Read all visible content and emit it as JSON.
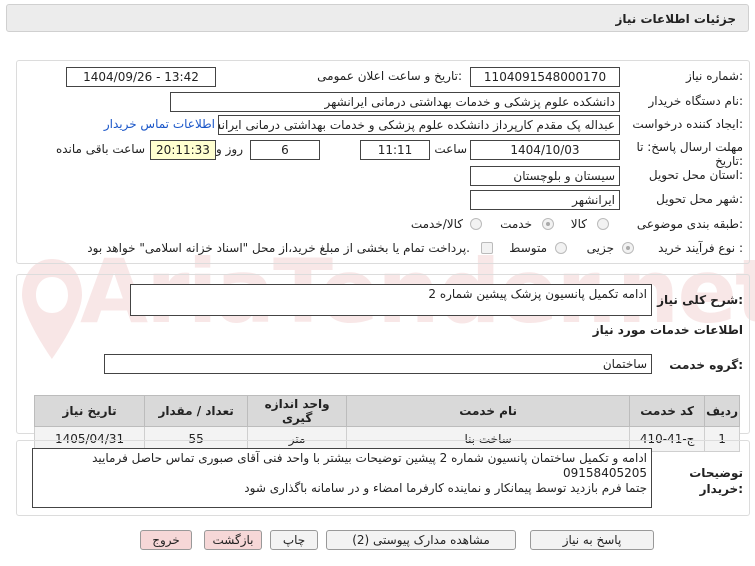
{
  "header": {
    "title": "جزئیات اطلاعات نیاز"
  },
  "watermark": "AriaTender.net",
  "form": {
    "need_number_label": "شماره نیاز:",
    "need_number": "1104091548000170",
    "announce_label": "تاریخ و ساعت اعلان عمومی:",
    "announce_value": "1404/09/26 - 13:42",
    "buyer_label": "نام دستگاه خریدار:",
    "buyer_value": "دانشکده علوم پزشکی و خدمات بهداشتی درمانی ایرانشهر",
    "creator_label": "ایجاد کننده درخواست:",
    "creator_value": "عبداله پک مقدم کارپرداز دانشکده علوم پزشکی و خدمات بهداشتی درمانی ایرانشهر",
    "contact_link": "اطلاعات تماس خریدار",
    "deadline_label": "مهلت ارسال پاسخ: تا تاریخ:",
    "deadline_date": "1404/10/03",
    "time_label": "ساعت",
    "deadline_time": "11:11",
    "days_value": "6",
    "days_label": "روز و",
    "remaining_time": "20:11:33",
    "remaining_label": "ساعت باقی مانده",
    "province_label": "استان محل تحویل:",
    "province_value": "سیستان و بلوچستان",
    "city_label": "شهر محل تحویل:",
    "city_value": "ایرانشهر",
    "category_label": "طبقه بندی موضوعی:",
    "category_options": [
      "کالا",
      "خدمت",
      "کالا/خدمت"
    ],
    "process_label": "نوع فرآیند خرید :",
    "process_options": [
      "جزیی",
      "متوسط"
    ],
    "payment_note": "پرداخت تمام یا بخشی از مبلغ خرید،از محل \"اسناد خزانه اسلامی\" خواهد بود."
  },
  "summary": {
    "label": "شرح کلی نیاز:",
    "value": "ادامه تکمیل پانسیون پزشک پیشین شماره 2"
  },
  "services": {
    "section_title": "اطلاعات خدمات مورد نیاز",
    "group_label": "گروه خدمت:",
    "group_value": "ساختمان",
    "columns": [
      "ردیف",
      "کد خدمت",
      "نام خدمت",
      "واحد اندازه گیری",
      "تعداد / مقدار",
      "تاریخ نیاز"
    ],
    "rows": [
      [
        "1",
        "ج-41-410",
        "ساخت بنا",
        "متر",
        "55",
        "1405/04/31"
      ]
    ]
  },
  "notes": {
    "label": "توضیحات خریدار:",
    "line1": "ادامه و تکمیل ساختمان پانسیون شماره 2 پیشین  توضیحات بیشتر با واحد فنی آقای صبوری تماس حاصل فرمایید",
    "line2": "09158405205",
    "line3": "جتما فرم بازدید توسط پیمانکار و نماینده کارفرما امضاء و در سامانه باگذاری شود"
  },
  "buttons": {
    "reply": "پاسخ به نیاز",
    "attachments": "مشاهده مدارک پیوستی (2)",
    "print": "چاپ",
    "back": "بازگشت",
    "exit": "خروج"
  }
}
